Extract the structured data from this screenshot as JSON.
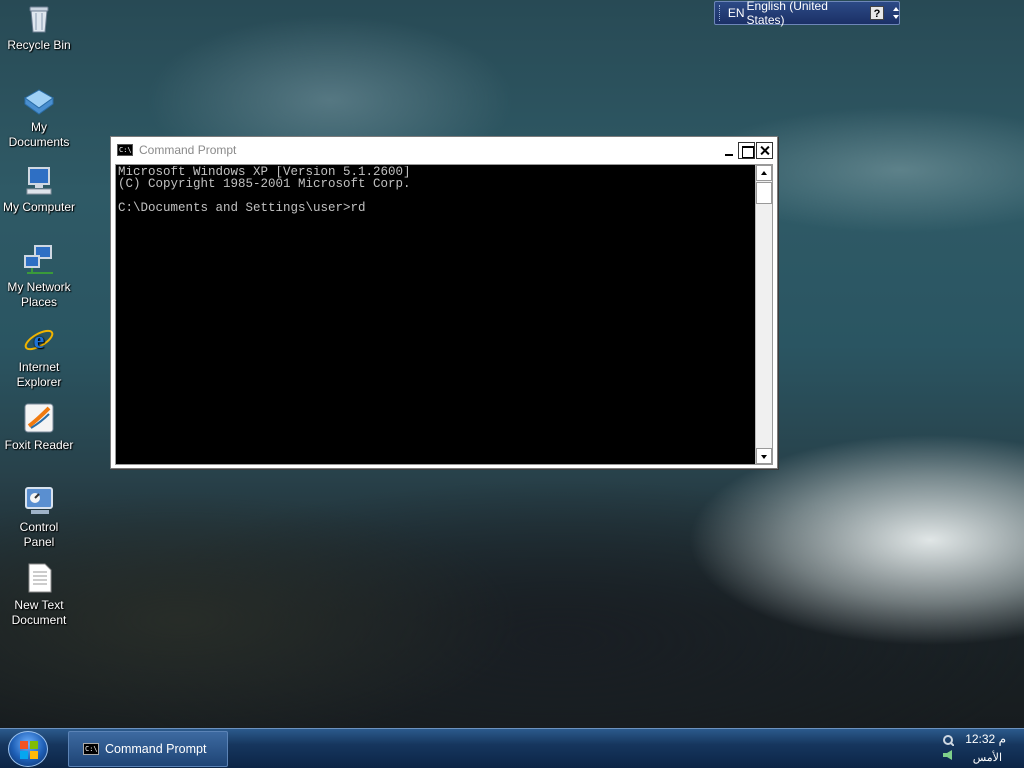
{
  "desktop": {
    "icons": [
      {
        "label_line1": "Recycle Bin",
        "label_line2": "",
        "icon": "recycle-bin-icon"
      },
      {
        "label_line1": "My",
        "label_line2": "Documents",
        "icon": "my-documents-icon"
      },
      {
        "label_line1": "My Computer",
        "label_line2": "",
        "icon": "my-computer-icon"
      },
      {
        "label_line1": "My Network",
        "label_line2": "Places",
        "icon": "network-places-icon"
      },
      {
        "label_line1": "Internet",
        "label_line2": "Explorer",
        "icon": "internet-explorer-icon"
      },
      {
        "label_line1": "Foxit Reader",
        "label_line2": "",
        "icon": "foxit-reader-icon"
      },
      {
        "label_line1": "Control",
        "label_line2": "Panel",
        "icon": "control-panel-icon"
      },
      {
        "label_line1": "New Text",
        "label_line2": "Document",
        "icon": "text-document-icon"
      }
    ]
  },
  "language_bar": {
    "code": "EN",
    "language": "English (United States)",
    "help": "?"
  },
  "cmd_window": {
    "title": "Command Prompt",
    "icon_text": "C:\\",
    "lines": [
      "Microsoft Windows XP [Version 5.1.2600]",
      "(C) Copyright 1985-2001 Microsoft Corp.",
      "",
      "C:\\Documents and Settings\\user>rd"
    ]
  },
  "taskbar": {
    "task_label": "Command Prompt",
    "task_icon_text": "C:\\",
    "clock": "12:32 م",
    "day": "الأمس"
  },
  "colors": {
    "console_bg": "#000000",
    "console_fg": "#c0c0c0",
    "taskbar": "#16365e"
  }
}
